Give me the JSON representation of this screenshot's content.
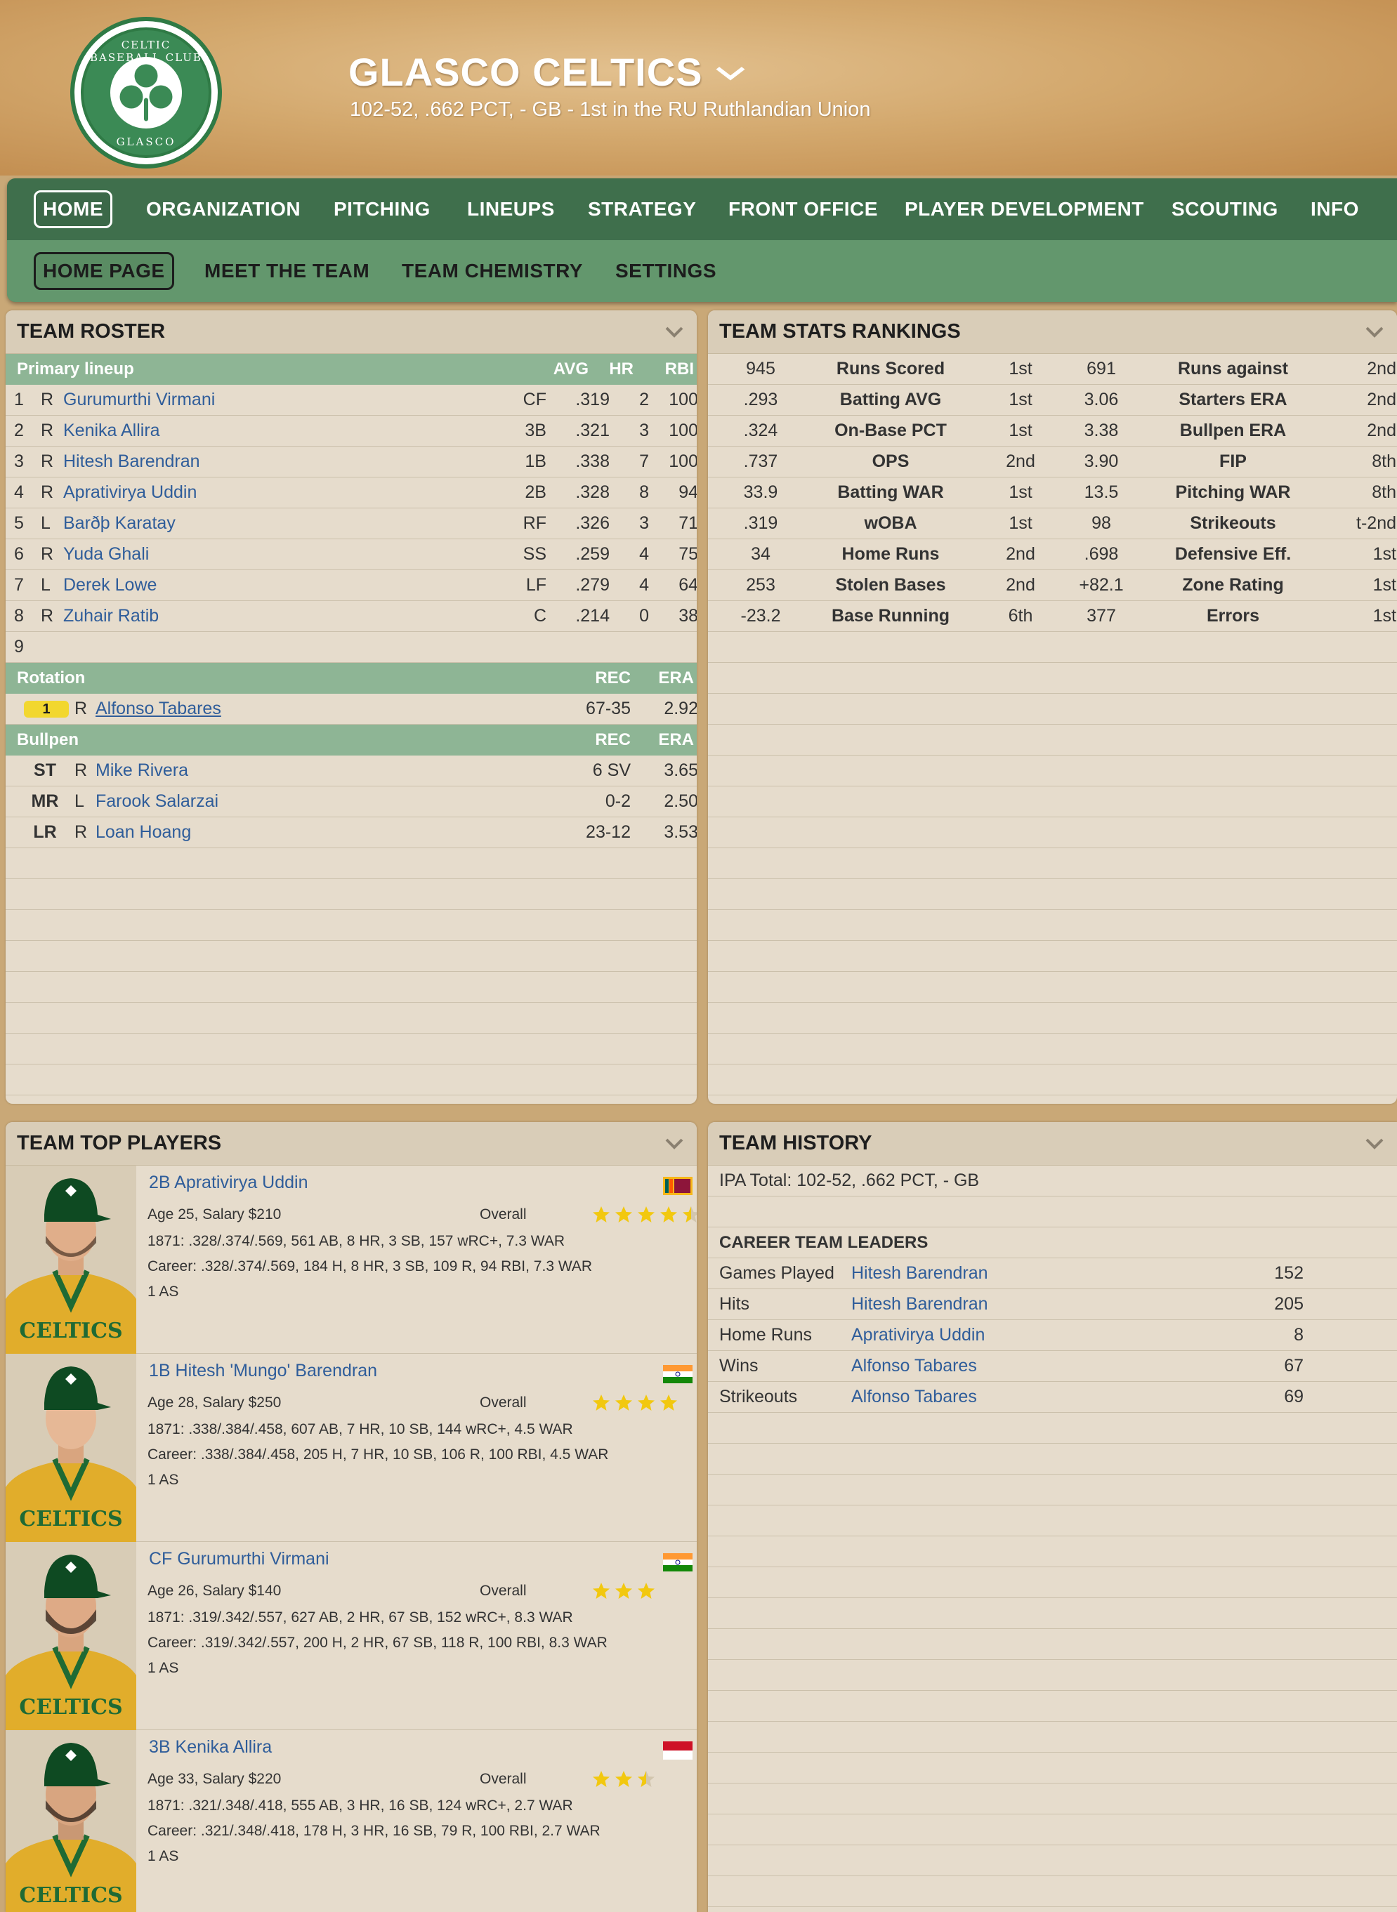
{
  "header": {
    "logo_text_top": "CELTIC BASEBALL CLUB",
    "logo_text_bottom": "GLASCO",
    "team_name": "GLASCO CELTICS",
    "team_sub": "102-52, .662 PCT, - GB - 1st in the RU Ruthlandian Union"
  },
  "nav": {
    "main": [
      "HOME",
      "ORGANIZATION",
      "PITCHING",
      "LINEUPS",
      "STRATEGY",
      "FRONT OFFICE",
      "PLAYER DEVELOPMENT",
      "SCOUTING",
      "INFO"
    ],
    "sub": [
      "HOME PAGE",
      "MEET THE TEAM",
      "TEAM CHEMISTRY",
      "SETTINGS"
    ]
  },
  "roster": {
    "title": "TEAM ROSTER",
    "lineup_header": {
      "label": "Primary lineup",
      "avg": "AVG",
      "hr": "HR",
      "rbi": "RBI"
    },
    "lineup": [
      {
        "num": "1",
        "hand": "R",
        "name": "Gurumurthi Virmani",
        "pos": "CF",
        "avg": ".319",
        "hr": "2",
        "rbi": "100"
      },
      {
        "num": "2",
        "hand": "R",
        "name": "Kenika Allira",
        "pos": "3B",
        "avg": ".321",
        "hr": "3",
        "rbi": "100"
      },
      {
        "num": "3",
        "hand": "R",
        "name": "Hitesh Barendran",
        "pos": "1B",
        "avg": ".338",
        "hr": "7",
        "rbi": "100"
      },
      {
        "num": "4",
        "hand": "R",
        "name": "Aprativirya Uddin",
        "pos": "2B",
        "avg": ".328",
        "hr": "8",
        "rbi": "94"
      },
      {
        "num": "5",
        "hand": "L",
        "name": "Barðþ Karatay",
        "pos": "RF",
        "avg": ".326",
        "hr": "3",
        "rbi": "71"
      },
      {
        "num": "6",
        "hand": "R",
        "name": "Yuda Ghali",
        "pos": "SS",
        "avg": ".259",
        "hr": "4",
        "rbi": "75"
      },
      {
        "num": "7",
        "hand": "L",
        "name": "Derek Lowe",
        "pos": "LF",
        "avg": ".279",
        "hr": "4",
        "rbi": "64"
      },
      {
        "num": "8",
        "hand": "R",
        "name": "Zuhair Ratib",
        "pos": "C",
        "avg": ".214",
        "hr": "0",
        "rbi": "38"
      }
    ],
    "empty_slot": "9",
    "rotation_header": {
      "label": "Rotation",
      "rec": "REC",
      "era": "ERA"
    },
    "rotation": [
      {
        "slot": "1",
        "hand": "R",
        "name": "Alfonso Tabares",
        "rec": "67-35",
        "era": "2.92"
      }
    ],
    "bullpen_header": {
      "label": "Bullpen",
      "rec": "REC",
      "era": "ERA"
    },
    "bullpen": [
      {
        "role": "ST",
        "hand": "R",
        "name": "Mike Rivera",
        "rec": "6 SV",
        "era": "3.65"
      },
      {
        "role": "MR",
        "hand": "L",
        "name": "Farook Salarzai",
        "rec": "0-2",
        "era": "2.50"
      },
      {
        "role": "LR",
        "hand": "R",
        "name": "Loan Hoang",
        "rec": "23-12",
        "era": "3.53"
      }
    ]
  },
  "stats": {
    "title": "TEAM STATS RANKINGS",
    "rows": [
      {
        "v1": "945",
        "l1": "Runs Scored",
        "r1": "1st",
        "v2": "691",
        "l2": "Runs against",
        "r2": "2nd"
      },
      {
        "v1": ".293",
        "l1": "Batting AVG",
        "r1": "1st",
        "v2": "3.06",
        "l2": "Starters ERA",
        "r2": "2nd"
      },
      {
        "v1": ".324",
        "l1": "On-Base PCT",
        "r1": "1st",
        "v2": "3.38",
        "l2": "Bullpen ERA",
        "r2": "2nd"
      },
      {
        "v1": ".737",
        "l1": "OPS",
        "r1": "2nd",
        "v2": "3.90",
        "l2": "FIP",
        "r2": "8th"
      },
      {
        "v1": "33.9",
        "l1": "Batting WAR",
        "r1": "1st",
        "v2": "13.5",
        "l2": "Pitching WAR",
        "r2": "8th"
      },
      {
        "v1": ".319",
        "l1": "wOBA",
        "r1": "1st",
        "v2": "98",
        "l2": "Strikeouts",
        "r2": "t-2nd"
      },
      {
        "v1": "34",
        "l1": "Home Runs",
        "r1": "2nd",
        "v2": ".698",
        "l2": "Defensive Eff.",
        "r2": "1st"
      },
      {
        "v1": "253",
        "l1": "Stolen Bases",
        "r1": "2nd",
        "v2": "+82.1",
        "l2": "Zone Rating",
        "r2": "1st"
      },
      {
        "v1": "-23.2",
        "l1": "Base Running",
        "r1": "6th",
        "v2": "377",
        "l2": "Errors",
        "r2": "1st"
      }
    ]
  },
  "top_players": {
    "title": "TEAM TOP PLAYERS",
    "players": [
      {
        "name": "2B Aprativirya Uddin",
        "age_salary": "Age 25, Salary $210",
        "overall_label": "Overall",
        "stars": 4.5,
        "flag": "sri-lanka-flag",
        "season": "1871: .328/.374/.569, 561 AB, 8 HR, 3 SB, 157 wRC+, 7.3 WAR",
        "career": "Career: .328/.374/.569, 184 H, 8 HR, 3 SB, 109 R, 94 RBI, 7.3 WAR",
        "awards": "1 AS"
      },
      {
        "name": "1B Hitesh 'Mungo' Barendran",
        "age_salary": "Age 28, Salary $250",
        "overall_label": "Overall",
        "stars": 4,
        "flag": "india-flag",
        "season": "1871: .338/.384/.458, 607 AB, 7 HR, 10 SB, 144 wRC+, 4.5 WAR",
        "career": "Career: .338/.384/.458, 205 H, 7 HR, 10 SB, 106 R, 100 RBI, 4.5 WAR",
        "awards": "1 AS"
      },
      {
        "name": "CF Gurumurthi Virmani",
        "age_salary": "Age 26, Salary $140",
        "overall_label": "Overall",
        "stars": 3,
        "flag": "india-flag",
        "season": "1871: .319/.342/.557, 627 AB, 2 HR, 67 SB, 152 wRC+, 8.3 WAR",
        "career": "Career: .319/.342/.557, 200 H, 2 HR, 67 SB, 118 R, 100 RBI, 8.3 WAR",
        "awards": "1 AS"
      },
      {
        "name": "3B Kenika Allira",
        "age_salary": "Age 33, Salary $220",
        "overall_label": "Overall",
        "stars": 2.5,
        "flag": "indonesia-flag",
        "season": "1871: .321/.348/.418, 555 AB, 3 HR, 16 SB, 124 wRC+, 2.7 WAR",
        "career": "Career: .321/.348/.418, 178 H, 3 HR, 16 SB, 79 R, 100 RBI, 2.7 WAR",
        "awards": "1 AS"
      }
    ]
  },
  "history": {
    "title": "TEAM HISTORY",
    "ipa_total": "IPA Total: 102-52, .662 PCT, - GB",
    "leaders_title": "CAREER TEAM LEADERS",
    "leaders": [
      {
        "label": "Games Played",
        "player": "Hitesh Barendran",
        "value": "152"
      },
      {
        "label": "Hits",
        "player": "Hitesh Barendran",
        "value": "205"
      },
      {
        "label": "Home Runs",
        "player": "Aprativirya Uddin",
        "value": "8"
      },
      {
        "label": "Wins",
        "player": "Alfonso Tabares",
        "value": "67"
      },
      {
        "label": "Strikeouts",
        "player": "Alfonso Tabares",
        "value": "69"
      }
    ]
  },
  "colors": {
    "nav_dark": "#3f6f4c",
    "nav_light": "#63976d",
    "section_green": "#8eb595",
    "link_blue": "#2f5d9a",
    "star_yellow": "#f2c80f",
    "badge_yellow": "#f2d72f"
  }
}
